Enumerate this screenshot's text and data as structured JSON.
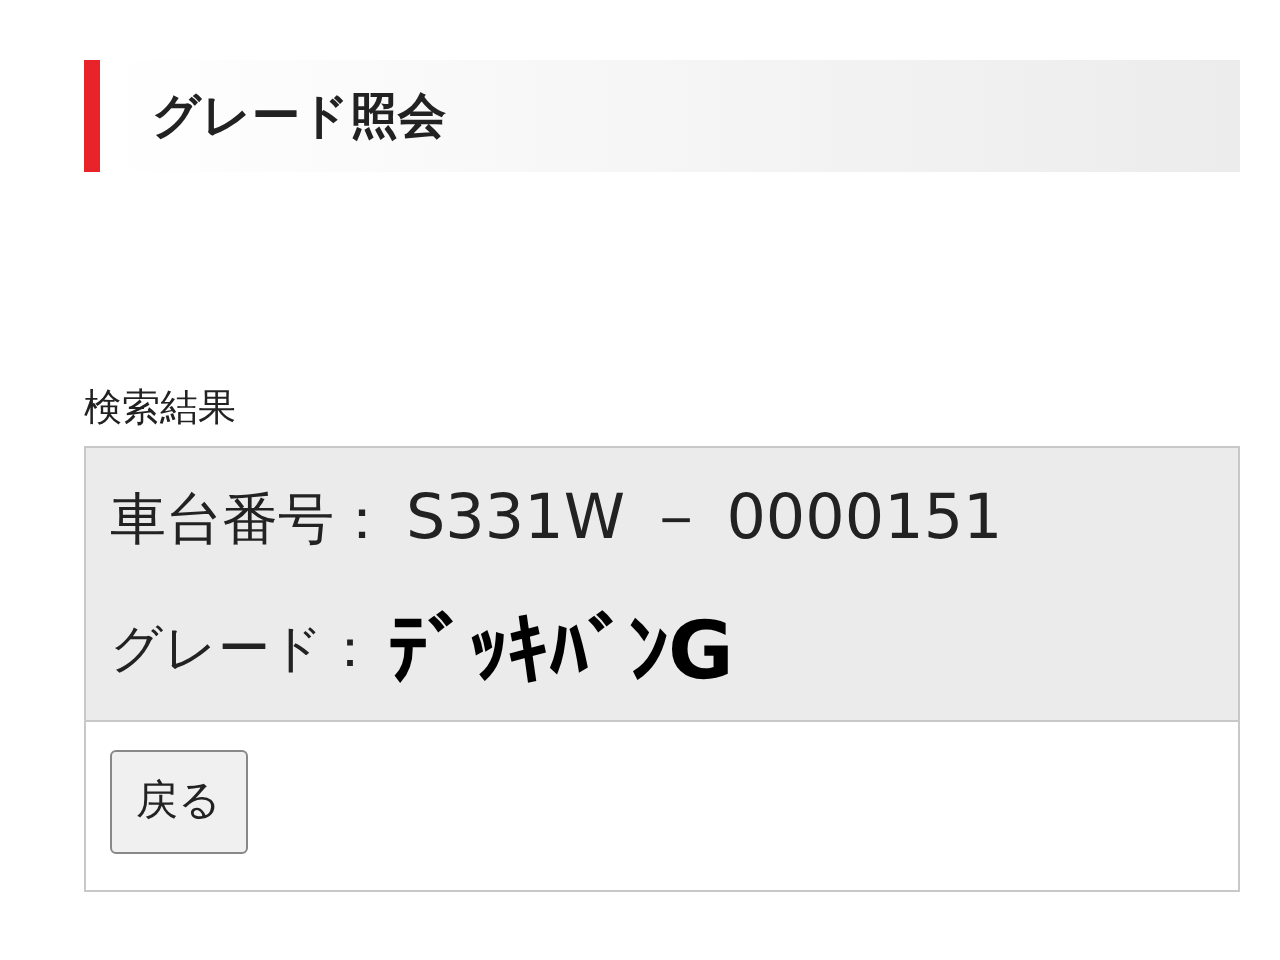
{
  "heading": "グレード照会",
  "results": {
    "caption": "検索結果",
    "fields": [
      {
        "label": "車台番号：",
        "value": "S331W － 0000151",
        "kind": "plain"
      },
      {
        "label": "グレード：",
        "value": "ﾃﾞｯｷﾊﾞﾝG",
        "kind": "bold"
      }
    ]
  },
  "buttons": [
    "戻る"
  ]
}
